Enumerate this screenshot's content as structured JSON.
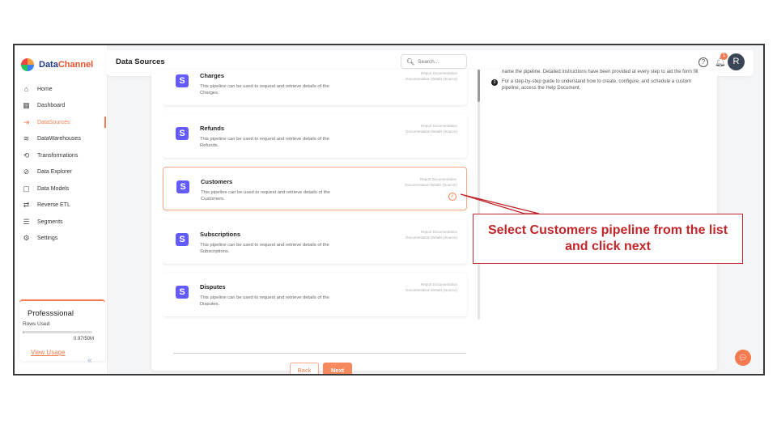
{
  "app": {
    "brand_part1": "Data",
    "brand_part2": "Channel"
  },
  "sidebar": {
    "items": [
      {
        "label": "Home",
        "icon": "home-icon",
        "glyph": "⌂",
        "active": false
      },
      {
        "label": "Dashboard",
        "icon": "dashboard-icon",
        "glyph": "▦",
        "active": false
      },
      {
        "label": "DataSources",
        "icon": "datasources-icon",
        "glyph": "⇥",
        "active": true
      },
      {
        "label": "DataWarehouses",
        "icon": "database-icon",
        "glyph": "≋",
        "active": false
      },
      {
        "label": "Transformations",
        "icon": "transform-icon",
        "glyph": "⟲",
        "active": false
      },
      {
        "label": "Data Explorer",
        "icon": "explorer-icon",
        "glyph": "⊘",
        "active": false
      },
      {
        "label": "Data Models",
        "icon": "models-icon",
        "glyph": "▢",
        "active": false
      },
      {
        "label": "Reverse ETL",
        "icon": "reverse-etl-icon",
        "glyph": "⇄",
        "active": false
      },
      {
        "label": "Segments",
        "icon": "segments-icon",
        "glyph": "☰",
        "active": false
      },
      {
        "label": "Settings",
        "icon": "settings-icon",
        "glyph": "⚙",
        "active": false
      }
    ]
  },
  "plan": {
    "title": "Professsional",
    "rows_label": "Rows Used",
    "count": "0.97/50M",
    "usage_fraction": 0.02,
    "link": "View Usage"
  },
  "header": {
    "title": "Data Sources",
    "search_placeholder": "Search...",
    "help_glyph": "?",
    "notification_count": "1",
    "avatar_initial": "R"
  },
  "pipelines": [
    {
      "name": "Charges",
      "description": "This pipeline can be used to request and retrieve details of the Charges.",
      "docs": [
        "Report Documentation",
        "Documentation Details (Source)"
      ],
      "selected": false
    },
    {
      "name": "Refunds",
      "description": "This pipeline can be used to request and retrieve details of the Refunds.",
      "docs": [
        "Report Documentation",
        "Documentation Details (Source)"
      ],
      "selected": false
    },
    {
      "name": "Customers",
      "description": "This pipeline can be used to request and retrieve details of the Customers.",
      "docs": [
        "Report Documentation",
        "Documentation Details (Source)"
      ],
      "selected": true
    },
    {
      "name": "Subscriptions",
      "description": "This pipeline can be used to request and retrieve details of the Subscriptions.",
      "docs": [
        "Report Documentation",
        "Documentation Details (Source)"
      ],
      "selected": false
    },
    {
      "name": "Disputes",
      "description": "This pipeline can be used to request and retrieve details of the Disputes.",
      "docs": [
        "Report Documentation",
        "Documentation Details (Source)"
      ],
      "selected": false
    }
  ],
  "pipeline_logo_letter": "S",
  "buttons": {
    "back": "Back",
    "next": "Next"
  },
  "instructions": [
    {
      "num": "",
      "text": "name the pipeline. Detailed instructions have been provided at every step to aid the form fill"
    },
    {
      "num": "3",
      "text": "For a step-by-step guide to understand how to create, configure, and schedule a custom pipeline, access the Help Document."
    }
  ],
  "callout": {
    "text": "Select Customers pipeline from the list and click next"
  },
  "colors": {
    "accent": "#f47b4f",
    "stripe": "#635bff",
    "callout": "#c0262a"
  }
}
